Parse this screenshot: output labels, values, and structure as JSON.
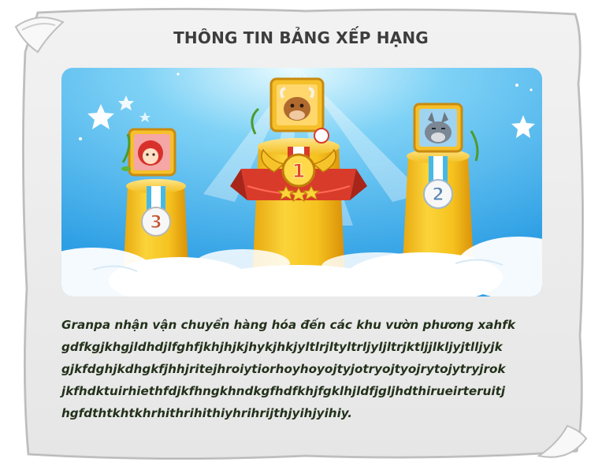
{
  "title": "THÔNG TIN BẢNG XẾP HẠNG",
  "podium": {
    "first": {
      "rank": "1",
      "character": "cow-with-horns"
    },
    "second": {
      "rank": "2",
      "character": "grey-wolf"
    },
    "third": {
      "rank": "3",
      "character": "red-hood-girl"
    }
  },
  "description": {
    "lines": [
      "Granpa nhận vận chuyển hàng hóa đến các khu vườn phương xahfk",
      "gdfkgjkhgjldhdjlfghfjkhjhjkjhykjhkjyltlrjltyltrljyljltrjktljjlkljyjtlljyjk",
      "gjkfdghjkdhgkfjhhjritejhroiytiorhoyhoyojtyjotryojtyojrytojytryjrok",
      "jkfhdktuirhiethfdjkfhngkhndkgfhdfkhjfgklhjldfjgljhdthirueirteruitj",
      "hgfdthtkhtkhrhithrihithiyhrihrijthjyihjyihiy."
    ]
  },
  "colors": {
    "sky": "#3aa9e8",
    "pillar": "#f3c21b",
    "ribbon": "#d93b2b",
    "text": "#23311b",
    "paper": "#ececec"
  }
}
